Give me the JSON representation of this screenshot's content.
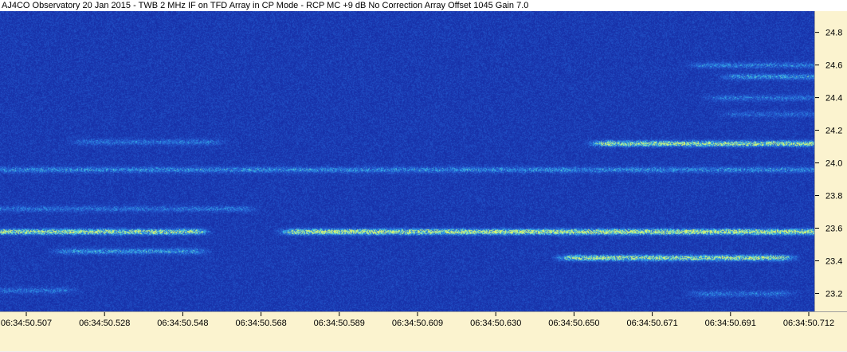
{
  "title": "AJ4CO Observatory 20 Jan 2015 - TWB 2 MHz IF on TFD Array in CP Mode - RCP  MC +9 dB  No Correction Array  Offset 1045  Gain 7.0",
  "colors": {
    "background_blue": "#1a35a8",
    "emission_cyan": "#3fc4e8",
    "emission_yellow": "#d8f56a",
    "axis_panel": "#fbf3cf"
  },
  "chart_data": {
    "type": "heatmap",
    "title": "AJ4CO Observatory 20 Jan 2015 - TWB 2 MHz IF on TFD Array in CP Mode - RCP  MC +9 dB  No Correction Array  Offset 1045  Gain 7.0",
    "xlabel": "",
    "ylabel": "",
    "x_ticks": [
      "06:34:50.507",
      "06:34:50.528",
      "06:34:50.548",
      "06:34:50.568",
      "06:34:50.589",
      "06:34:50.609",
      "06:34:50.630",
      "06:34:50.650",
      "06:34:50.671",
      "06:34:50.691",
      "06:34:50.712"
    ],
    "y_ticks": [
      "24.8",
      "24.6",
      "24.4",
      "24.2",
      "24.0",
      "23.8",
      "23.6",
      "23.4",
      "23.2"
    ],
    "y_tick_values": [
      24.8,
      24.6,
      24.4,
      24.2,
      24.0,
      23.8,
      23.6,
      23.4,
      23.2
    ],
    "ylim": [
      23.09,
      24.93
    ],
    "colormap": [
      "#1a35a8",
      "#2a5ad0",
      "#3fc4e8",
      "#d8f56a"
    ],
    "emission_bands": [
      {
        "freq": 23.58,
        "t_start": 0.0,
        "t_end": 0.24,
        "intensity": 0.9
      },
      {
        "freq": 23.58,
        "t_start": 0.36,
        "t_end": 1.0,
        "intensity": 1.0
      },
      {
        "freq": 23.42,
        "t_start": 0.7,
        "t_end": 0.96,
        "intensity": 0.9
      },
      {
        "freq": 23.46,
        "t_start": 0.08,
        "t_end": 0.24,
        "intensity": 0.5
      },
      {
        "freq": 24.12,
        "t_start": 0.74,
        "t_end": 1.0,
        "intensity": 0.9
      },
      {
        "freq": 23.96,
        "t_start": 0.0,
        "t_end": 1.0,
        "intensity": 0.45
      },
      {
        "freq": 24.13,
        "t_start": 0.1,
        "t_end": 0.26,
        "intensity": 0.35
      },
      {
        "freq": 24.6,
        "t_start": 0.86,
        "t_end": 1.0,
        "intensity": 0.4
      },
      {
        "freq": 24.53,
        "t_start": 0.9,
        "t_end": 1.0,
        "intensity": 0.5
      },
      {
        "freq": 24.4,
        "t_start": 0.88,
        "t_end": 1.0,
        "intensity": 0.35
      },
      {
        "freq": 24.3,
        "t_start": 0.9,
        "t_end": 1.0,
        "intensity": 0.3
      },
      {
        "freq": 23.72,
        "t_start": 0.0,
        "t_end": 0.3,
        "intensity": 0.35
      },
      {
        "freq": 23.2,
        "t_start": 0.86,
        "t_end": 0.96,
        "intensity": 0.35
      },
      {
        "freq": 23.22,
        "t_start": 0.0,
        "t_end": 0.08,
        "intensity": 0.35
      }
    ]
  }
}
